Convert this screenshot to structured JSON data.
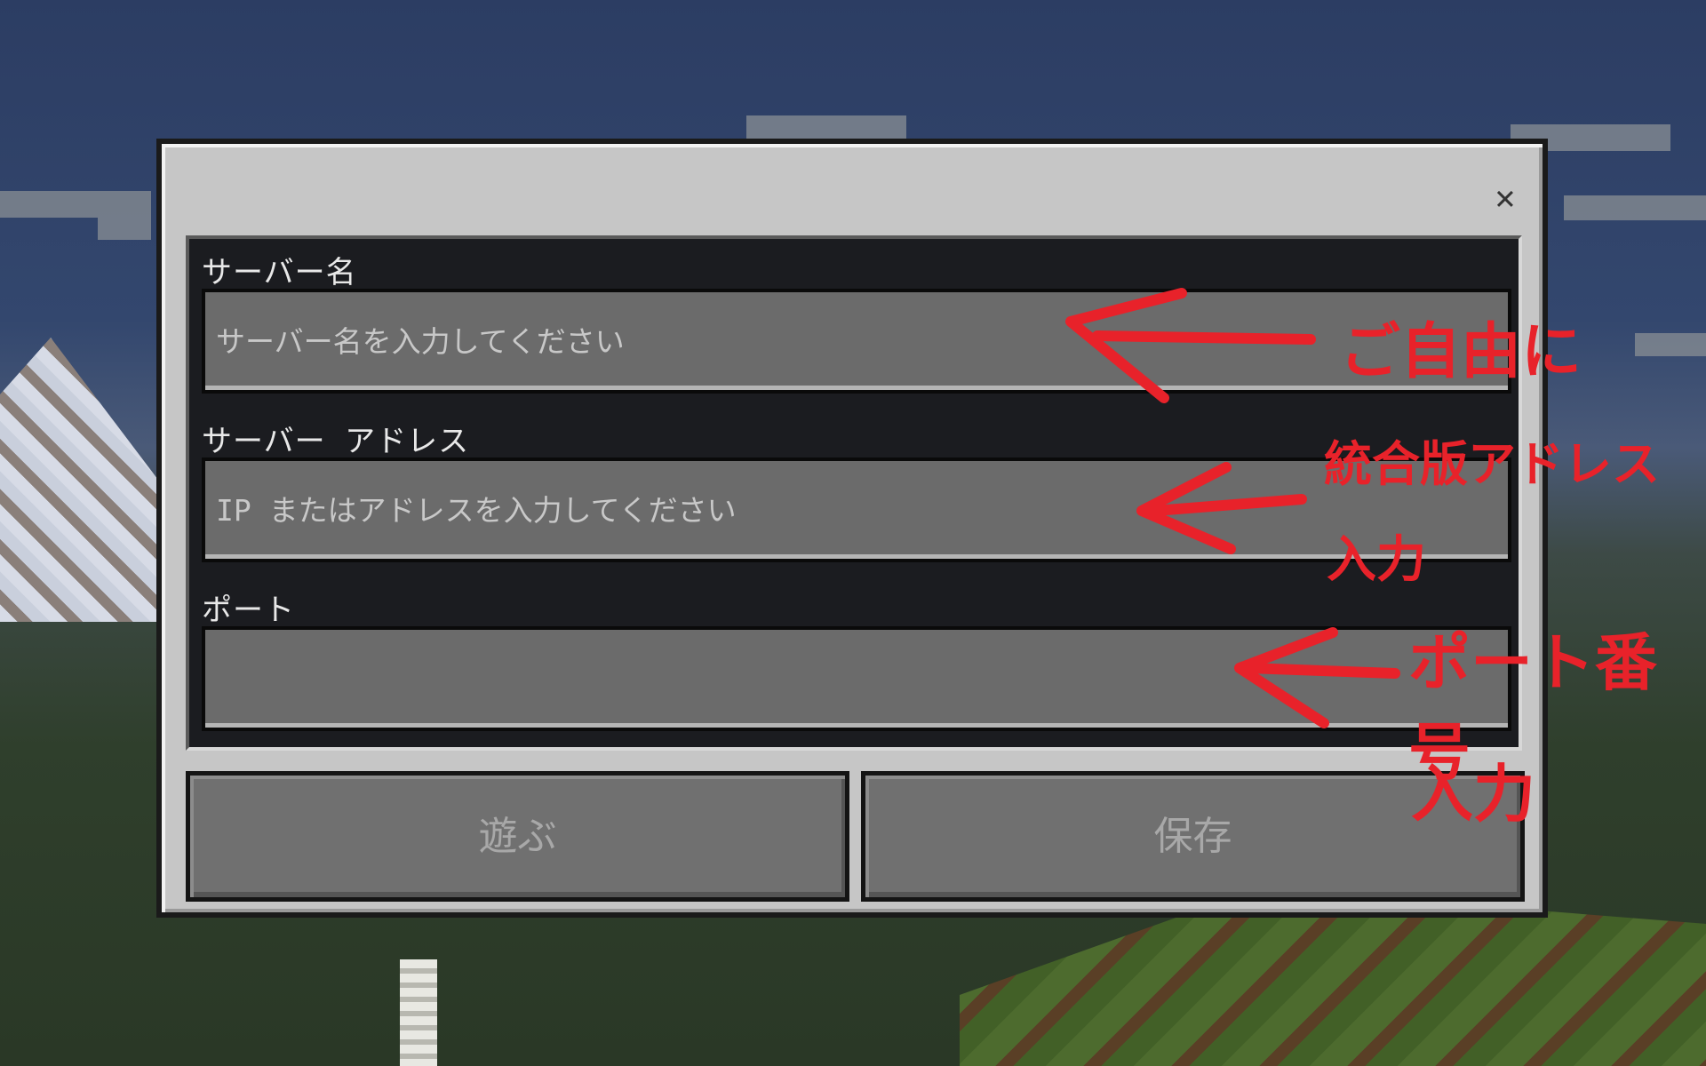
{
  "dialog": {
    "close_label": "✕",
    "fields": {
      "server_name": {
        "label": "サーバー名",
        "placeholder": "サーバー名を入力してください",
        "value": ""
      },
      "server_address": {
        "label": "サーバー アドレス",
        "placeholder": "IP またはアドレスを入力してください",
        "value": ""
      },
      "port": {
        "label": "ポート",
        "placeholder": "",
        "value": ""
      }
    },
    "buttons": {
      "play_label": "遊ぶ",
      "save_label": "保存"
    }
  },
  "annotations": {
    "server_name_note": "ご自由に",
    "address_note_line1": "統合版アドレス",
    "address_note_line2": "入力",
    "port_note_line1": "ポート番号",
    "port_note_line2": "入力",
    "color": "#e8222a"
  },
  "colors": {
    "dialog_bg": "#c6c6c6",
    "field_bg": "#6b6b6b",
    "panel_bg": "#1b1c20",
    "button_bg": "#707070"
  }
}
